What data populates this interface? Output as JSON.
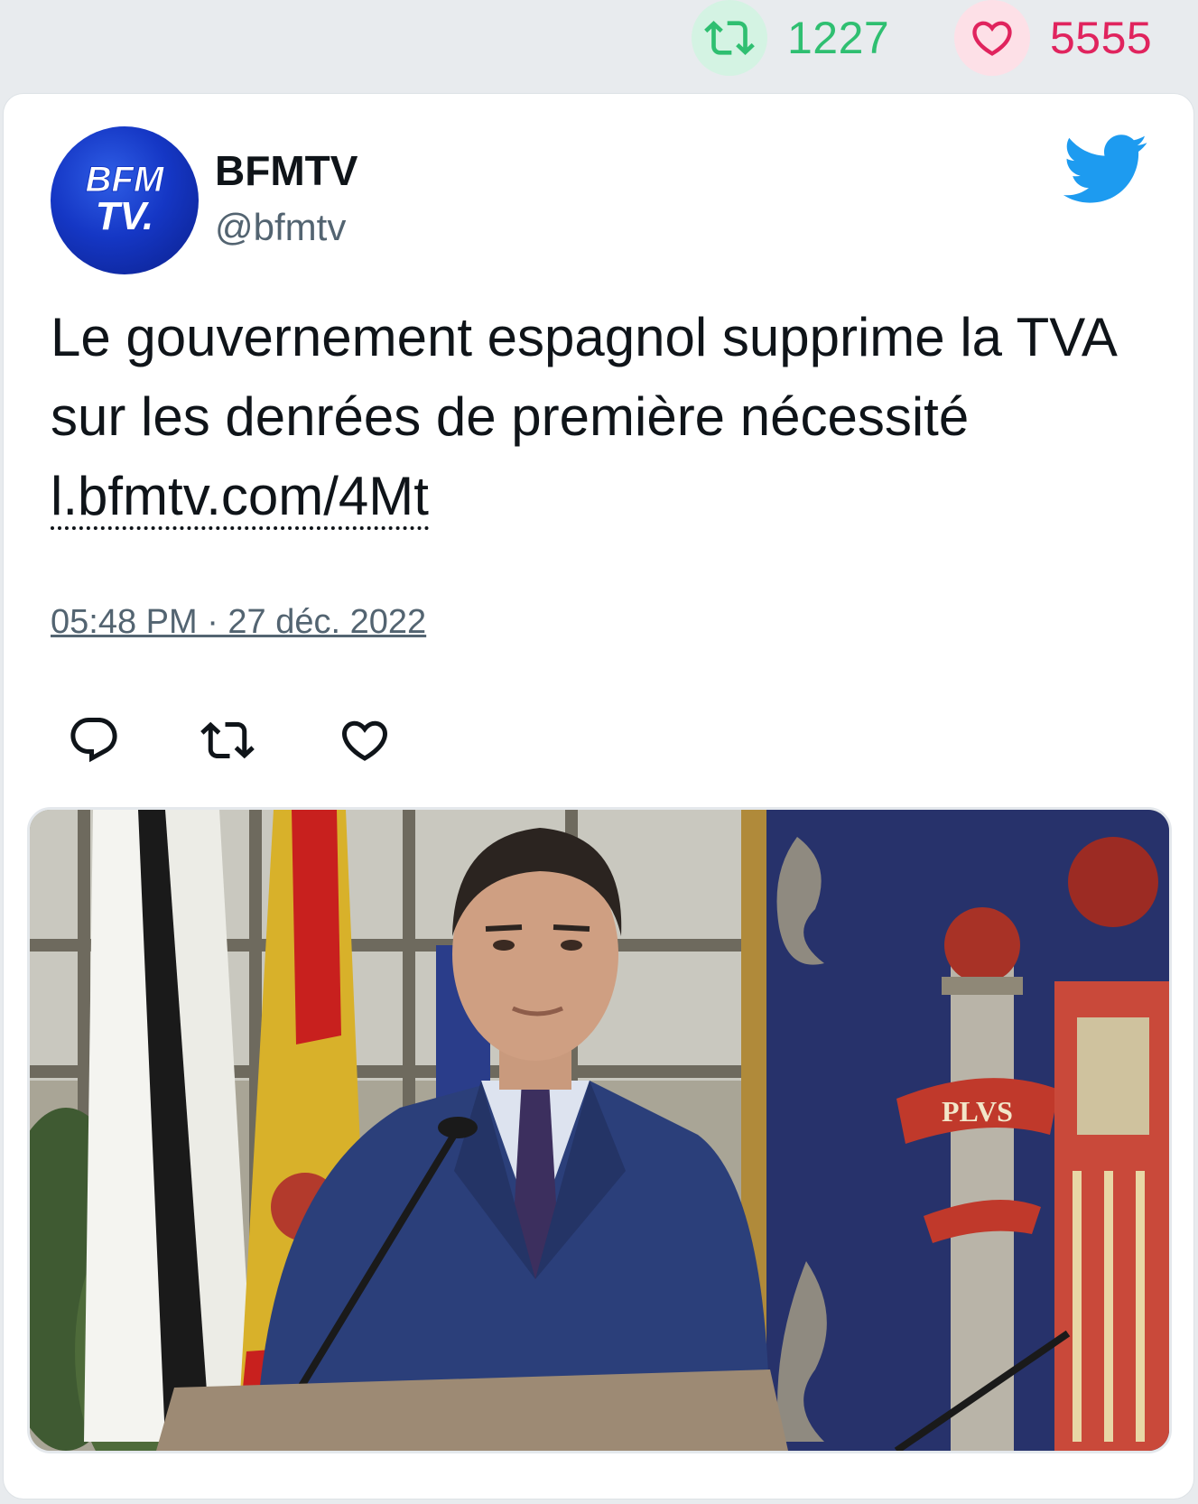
{
  "stats": {
    "retweets": "1227",
    "likes": "5555"
  },
  "author": {
    "name": "BFMTV",
    "handle": "@bfmtv",
    "avatar_text_top": "BFM",
    "avatar_text_bottom": "TV."
  },
  "tweet": {
    "text": "Le gouvernement espagnol supprime la TVA sur les denrées de première nécessité ",
    "link": "l.bfmtv.com/4Mt",
    "timestamp": "05:48 PM · 27 déc. 2022"
  },
  "media": {
    "caption_on_banner": "PLVS"
  },
  "colors": {
    "retweet_green": "#2fbf71",
    "like_red": "#e0245e",
    "twitter_blue": "#1d9bf0",
    "handle_gray": "#536471",
    "text_dark": "#0f1419"
  },
  "icons": {
    "retweet": "retweet-icon",
    "heart": "heart-icon",
    "reply": "reply-icon",
    "twitter": "twitter-bird-icon"
  }
}
